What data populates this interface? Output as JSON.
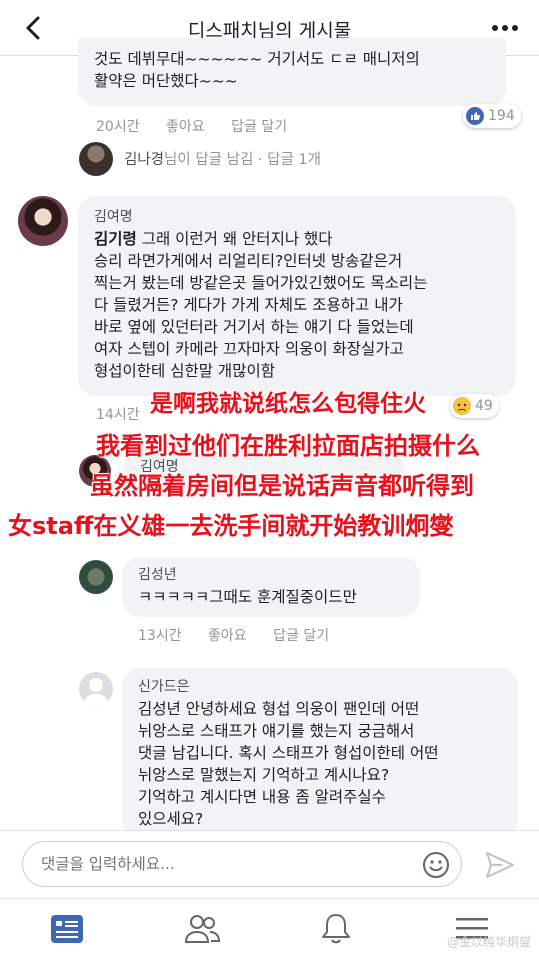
{
  "header": {
    "title": "디스패치님의 게시물"
  },
  "comment_top": {
    "text_line1": "것도 데뷔무대~~~~~~ 거기서도 ㄷㄹ 매니저의",
    "text_line2": "활약은 머단했다~~~",
    "time": "20시간",
    "like_label": "좋아요",
    "reply_label": "답글 달기",
    "reaction_count": "194"
  },
  "reply_summary": {
    "name": "김나경",
    "text": "님이 답글 남김 · 답글 1개"
  },
  "comment_kim": {
    "author": "김여명",
    "tag": "김기령",
    "line1": " 그래 이런거 왜 안터지나 했다",
    "line2": "승리 라면가게에서 리얼리티?인터넷 방송같은거",
    "line3": "찍는거 봤는데 방같은곳 들어가있긴했어도 목소리는",
    "line4": "다 들렸거든? 게다가 가게 자체도 조용하고 내가",
    "line5": "바로 옆에 있던터라 거기서 하는 얘기 다 들었는데",
    "line6": "여자 스텝이 카메라 끄자마자 의웅이 화장실가고",
    "line7": "형섭이한테 심한말 개많이함",
    "time": "14시간",
    "reaction_count": "49"
  },
  "comment_hidden": {
    "author": "김여명"
  },
  "comment_ks": {
    "author": "김성년",
    "text": "ㅋㅋㅋㅋㅋ그때도 훈계질중이드만",
    "time": "13시간",
    "like_label": "좋아요",
    "reply_label": "답글 달기"
  },
  "comment_shin": {
    "author": "신가드은",
    "line1": "김성년 안녕하세요 형섭 의웅이 팬인데 어떤",
    "line2": "뉘앙스로 스태프가 얘기를 했는지 궁금해서",
    "line3": "댓글 남깁니다. 혹시 스태프가 형섭이한테 어떤",
    "line4": "뉘앙스로 말했는지 기억하고 계시나요?",
    "line5": "기억하고 계시다면 내용 좀 알려주실수",
    "line6": "있으세요?"
  },
  "overlay": {
    "line1": "是啊我就说纸怎么包得住火",
    "line2": "我看到过他们在胜利拉面店拍摄什么",
    "line3": "虽然隔着房间但是说话声音都听得到",
    "line4": "女staff在义雄一去洗手间就开始教训炯燮"
  },
  "composer": {
    "placeholder": "댓글을 입력하세요..."
  },
  "tabs": [
    "news-feed",
    "friends",
    "notifications",
    "menu"
  ],
  "watermark": "@金以纯华炯燮",
  "colors": {
    "accent": "#4267b2",
    "overlay_red": "#e8101a",
    "bubble": "#f2f3f5"
  }
}
